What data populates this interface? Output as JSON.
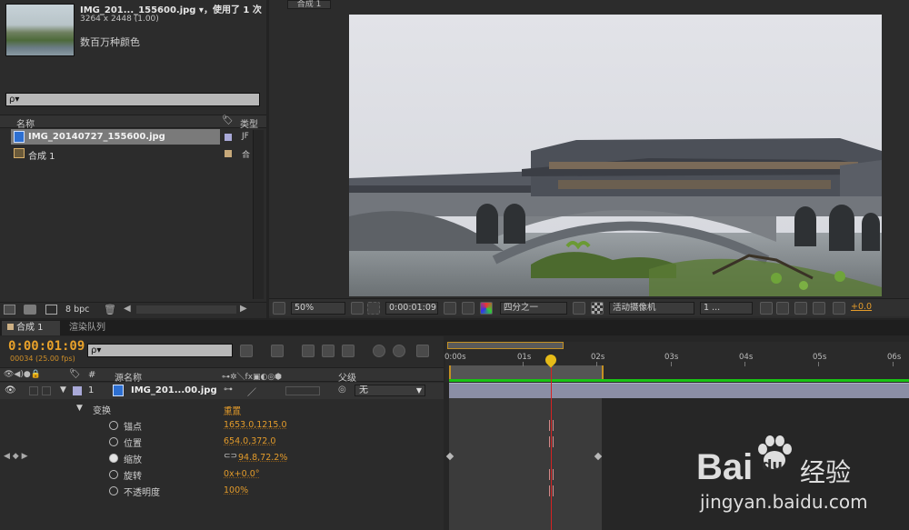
{
  "project": {
    "file_name": "IMG_201..._155600.jpg ▾，使用了 1 次",
    "dimensions": "3264 x 2448 (1.00)",
    "colors": "数百万种颜色",
    "search_placeholder": "ρ▾",
    "columns": {
      "name": "名称",
      "type": "类型"
    },
    "items": [
      {
        "name": "IMG_20140727_155600.jpg",
        "type": "JF"
      },
      {
        "name": "合成 1",
        "type": "合"
      }
    ],
    "footer_bpc": "8 bpc"
  },
  "viewer": {
    "tab": "合成 1",
    "zoom": "50%",
    "timecode": "0:00:01:09",
    "resolution": "四分之一",
    "camera": "活动摄像机",
    "views": "1 ...",
    "exposure": "+0.0"
  },
  "timeline": {
    "tab_comp": "合成 1",
    "tab_render": "渲染队列",
    "current_time": "0:00:01:09",
    "frame_info": "00034 (25.00 fps)",
    "search_placeholder": "ρ▾",
    "col_source_name": "源名称",
    "col_parent": "父级",
    "col_num": "#",
    "layer": {
      "index": "1",
      "name": "IMG_201...00.jpg",
      "parent": "无"
    },
    "transform": {
      "label": "变换",
      "reset": "重置"
    },
    "properties": [
      {
        "name": "锚点",
        "value": "1653.0,1215.0"
      },
      {
        "name": "位置",
        "value": "654.0,372.0"
      },
      {
        "name": "缩放",
        "value": "94.8,72.2%"
      },
      {
        "name": "旋转",
        "value": "0x+0.0°"
      },
      {
        "name": "不透明度",
        "value": "100%"
      }
    ],
    "ruler": [
      "0:00s",
      "01s",
      "02s",
      "03s",
      "04s",
      "05s",
      "06s"
    ]
  },
  "watermark": {
    "brand": "Bai",
    "brand2": "du",
    "cn": "经验",
    "url": "jingyan.baidu.com"
  },
  "colors": {
    "accent": "#e39b2b",
    "playhead": "#d62222",
    "layer_bar": "#8b8ea5",
    "green": "#19c313"
  }
}
